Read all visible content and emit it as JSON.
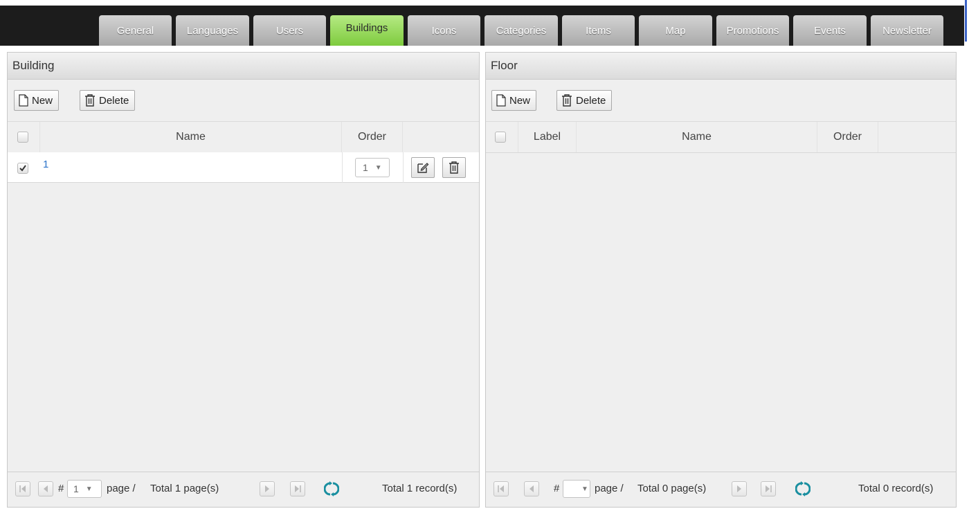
{
  "tabs": [
    {
      "label": "General",
      "active": false
    },
    {
      "label": "Languages",
      "active": false
    },
    {
      "label": "Users",
      "active": false
    },
    {
      "label": "Buildings",
      "active": true
    },
    {
      "label": "Icons",
      "active": false
    },
    {
      "label": "Categories",
      "active": false
    },
    {
      "label": "Items",
      "active": false
    },
    {
      "label": "Map",
      "active": false
    },
    {
      "label": "Promotions",
      "active": false
    },
    {
      "label": "Events",
      "active": false
    },
    {
      "label": "Newsletter",
      "active": false
    }
  ],
  "building": {
    "title": "Building",
    "new_label": "New",
    "delete_label": "Delete",
    "columns": {
      "name": "Name",
      "order": "Order"
    },
    "rows": [
      {
        "name": "1",
        "order": "1",
        "checked": true
      }
    ],
    "pager": {
      "hash": "#",
      "page": "1",
      "page_suffix": "page /",
      "total_pages": "Total 1 page(s)",
      "total_records": "Total 1 record(s)"
    }
  },
  "floor": {
    "title": "Floor",
    "new_label": "New",
    "delete_label": "Delete",
    "columns": {
      "label": "Label",
      "name": "Name",
      "order": "Order"
    },
    "rows": [],
    "pager": {
      "hash": "#",
      "page": "",
      "page_suffix": "page /",
      "total_pages": "Total 0 page(s)",
      "total_records": "Total 0 record(s)"
    }
  },
  "colors": {
    "active_tab": "#8fd64f",
    "tabbar": "#1c1c1c",
    "link": "#2b72c9",
    "refresh_icon": "#1a8fa0"
  }
}
